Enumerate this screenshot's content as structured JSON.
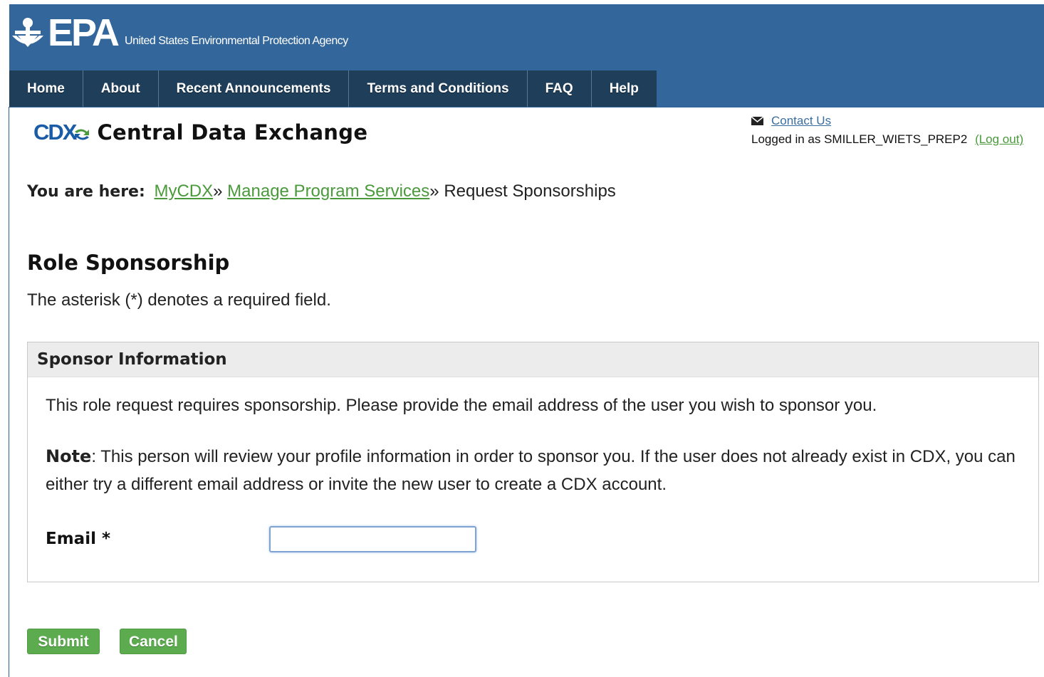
{
  "header": {
    "logo_text": "EPA",
    "agency_name": "United States Environmental Protection Agency",
    "brand_color": "#33679b",
    "nav_color": "#1f3e5a"
  },
  "nav": {
    "items": [
      "Home",
      "About",
      "Recent Announcements",
      "Terms and Conditions",
      "FAQ",
      "Help"
    ]
  },
  "cdx": {
    "logo_text": "CDX",
    "title": "Central Data Exchange",
    "logo_color": "#1b5ca6"
  },
  "user": {
    "contact_label": "Contact Us",
    "logged_in_prefix": "Logged in as SMILLER_WIETS_PREP2",
    "logout_label": "(Log out)",
    "icon": "envelope-icon"
  },
  "breadcrumb": {
    "prefix": "You are here:",
    "items": [
      "MyCDX",
      "Manage Program Services"
    ],
    "separator": "»",
    "current": "Request Sponsorships",
    "link_color": "#4a9a3c"
  },
  "page": {
    "title": "Role Sponsorship",
    "required_note": "The asterisk (*) denotes a required field."
  },
  "panel": {
    "heading": "Sponsor Information",
    "intro": "This role request requires sponsorship. Please provide the email address of the user you wish to sponsor you.",
    "note_label": "Note",
    "note_text": ": This person will review your profile information in order to sponsor you. If the user does not already exist in CDX, you can either try a different email address or invite the new user to create a CDX account.",
    "email_label": "Email *",
    "email_value": ""
  },
  "actions": {
    "submit_label": "Submit",
    "cancel_label": "Cancel",
    "button_color": "#5cab4f"
  }
}
